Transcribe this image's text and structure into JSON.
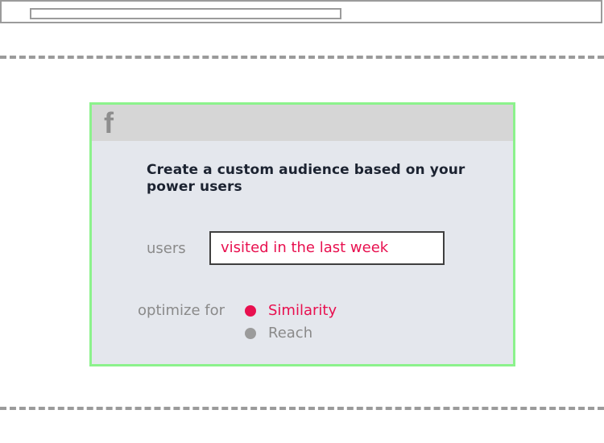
{
  "browser": {
    "address_value": ""
  },
  "card": {
    "icon": "facebook-icon",
    "icon_glyph": "f",
    "title": "Create a custom audience based on your power users",
    "users_label": "users",
    "users_value": "visited in the last week",
    "optimize_label": "optimize for",
    "options": [
      {
        "label": "Similarity",
        "selected": true
      },
      {
        "label": "Reach",
        "selected": false
      }
    ]
  },
  "colors": {
    "accent": "#e8104f",
    "card_border": "#8cf28c",
    "card_bg": "#e4e7ed",
    "header_bg": "#d6d6d6",
    "muted": "#9b9b9b"
  }
}
